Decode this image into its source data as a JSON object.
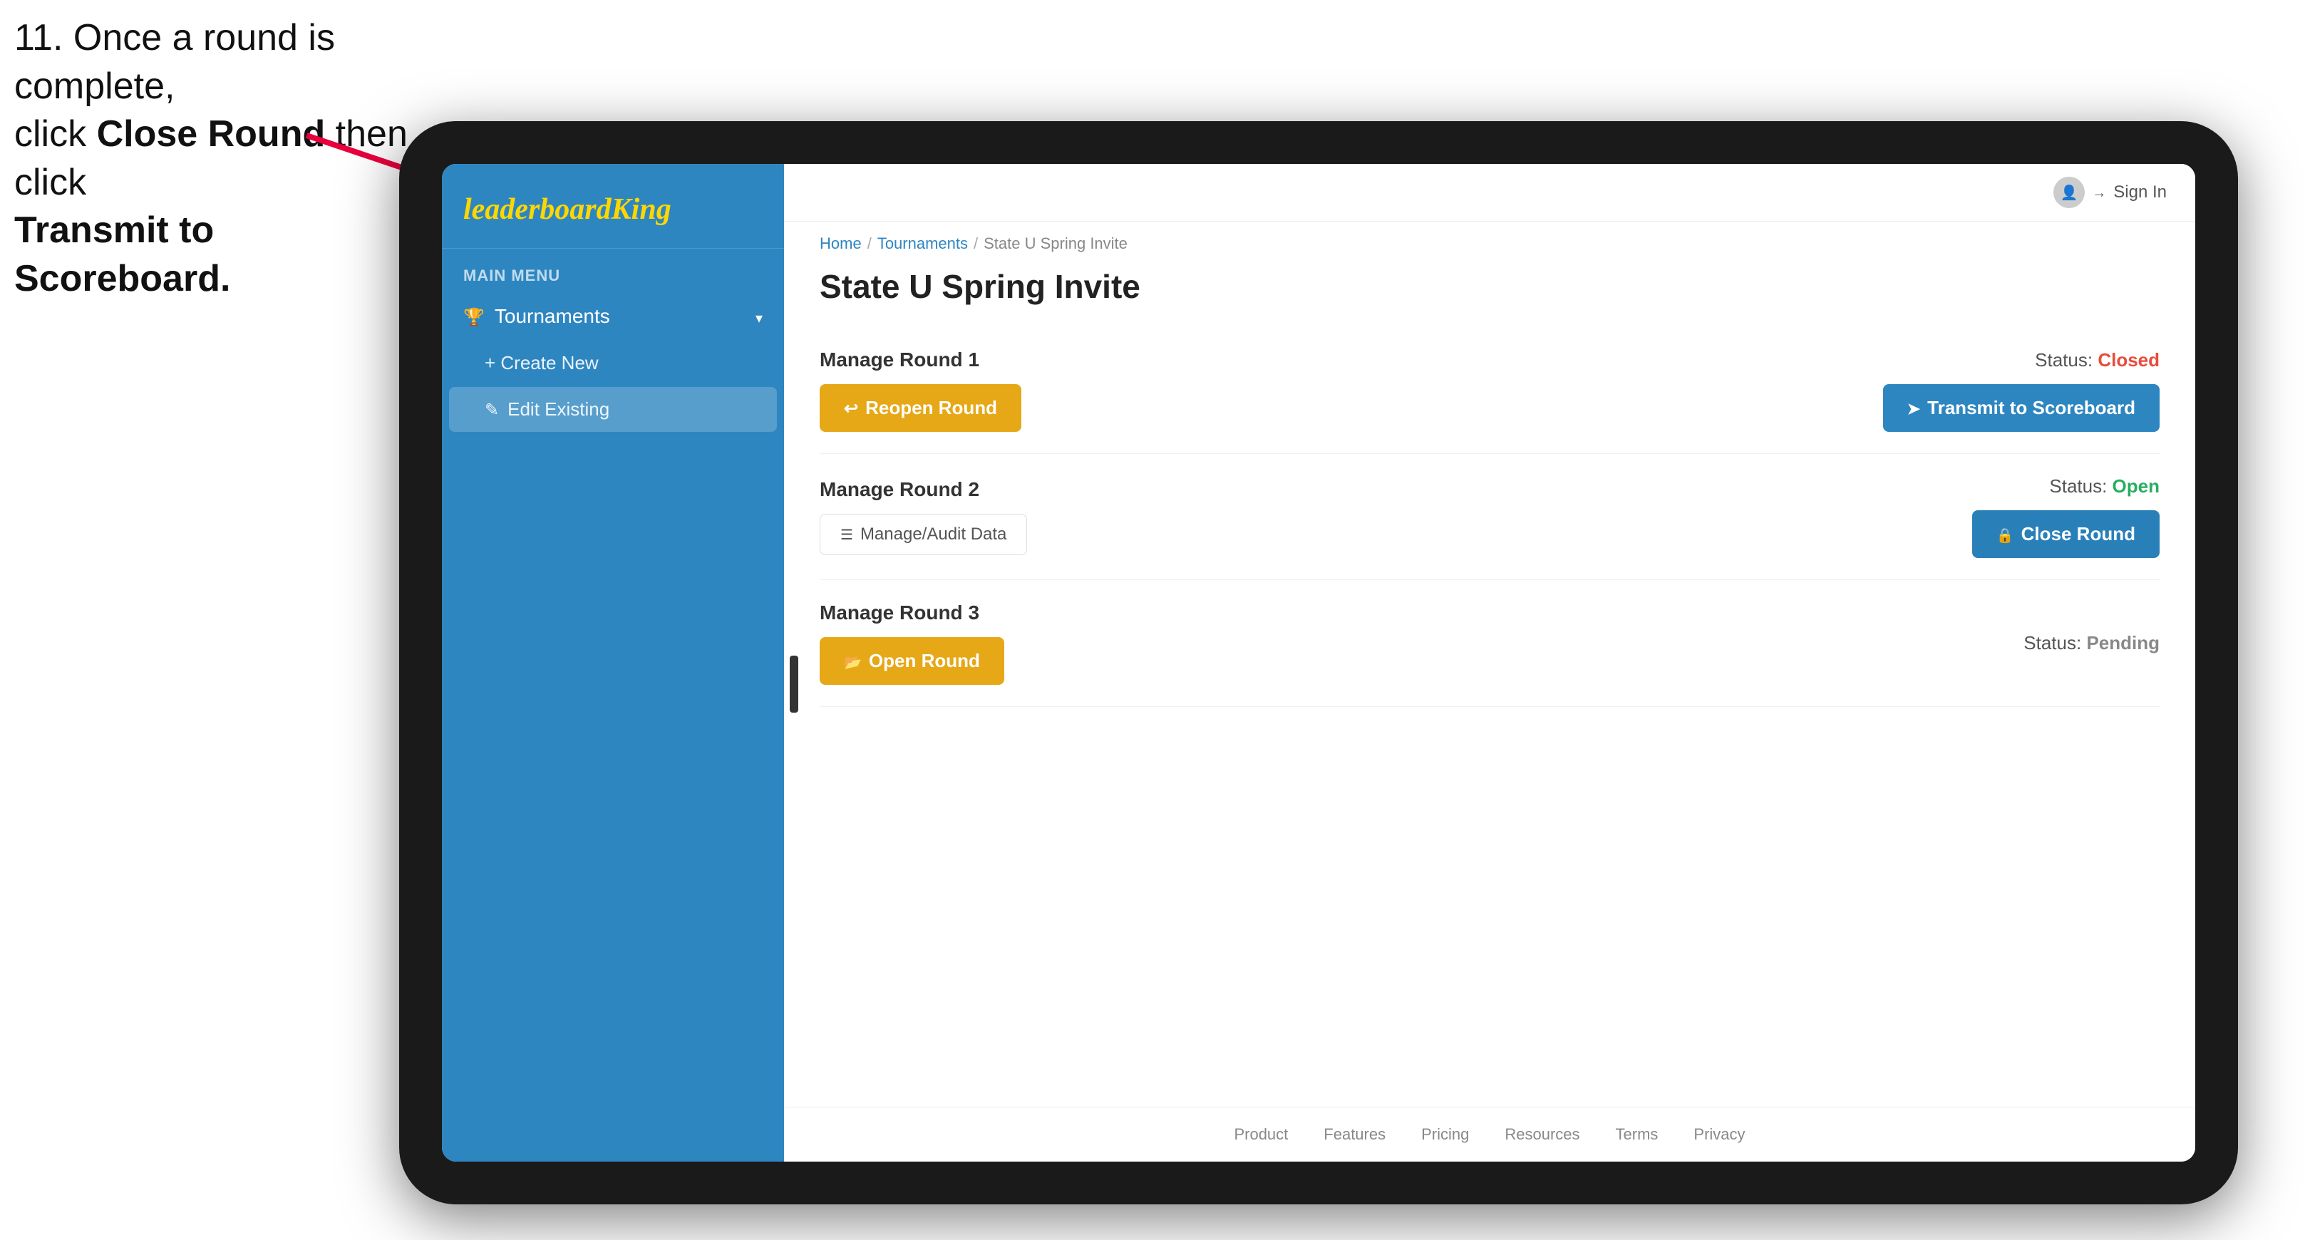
{
  "instruction": {
    "line1": "11. Once a round is complete,",
    "line2": "click ",
    "bold1": "Close Round",
    "line3": " then click",
    "bold2": "Transmit to Scoreboard."
  },
  "app": {
    "logo": {
      "text1": "leaderboard",
      "text2": "King"
    },
    "sidebar": {
      "main_menu_label": "MAIN MENU",
      "nav_items": [
        {
          "label": "Tournaments",
          "icon": "trophy",
          "expandable": true
        }
      ],
      "sub_items": [
        {
          "label": "+ Create New",
          "active": false
        },
        {
          "label": "Edit Existing",
          "active": true
        }
      ]
    },
    "header": {
      "sign_in": "Sign In"
    },
    "breadcrumb": {
      "home": "Home",
      "sep1": "/",
      "tournaments": "Tournaments",
      "sep2": "/",
      "current": "State U Spring Invite"
    },
    "page_title": "State U Spring Invite",
    "rounds": [
      {
        "id": "round1",
        "title": "Manage Round 1",
        "status_label": "Status:",
        "status_value": "Closed",
        "status_class": "status-closed",
        "btn1_label": "Reopen Round",
        "btn1_type": "gold",
        "btn2_label": "Transmit to Scoreboard",
        "btn2_type": "blue"
      },
      {
        "id": "round2",
        "title": "Manage Round 2",
        "status_label": "Status:",
        "status_value": "Open",
        "status_class": "status-open",
        "btn1_label": "Manage/Audit Data",
        "btn1_type": "small",
        "btn2_label": "Close Round",
        "btn2_type": "blue-dark"
      },
      {
        "id": "round3",
        "title": "Manage Round 3",
        "status_label": "Status:",
        "status_value": "Pending",
        "status_class": "status-pending",
        "btn1_label": "Open Round",
        "btn1_type": "gold",
        "btn2_label": null
      }
    ],
    "footer_links": [
      "Product",
      "Features",
      "Pricing",
      "Resources",
      "Terms",
      "Privacy"
    ]
  },
  "arrow": {
    "visible": true
  }
}
